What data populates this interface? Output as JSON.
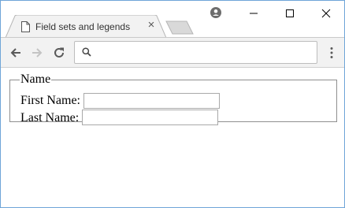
{
  "tab": {
    "title": "Field sets and legends",
    "favicon": "page-icon",
    "close": "×"
  },
  "window_controls": {
    "minimize": "minimize-icon",
    "maximize": "maximize-icon",
    "close": "close-icon"
  },
  "toolbar": {
    "address_value": "",
    "address_placeholder": ""
  },
  "form": {
    "legend": "Name",
    "first_name_label": "First Name:",
    "first_name_value": "",
    "last_name_label": "Last Name:",
    "last_name_value": ""
  },
  "colors": {
    "window_border": "#6fa5d8",
    "toolbar_bg": "#f2f2f2",
    "tab_bg": "#f2f2f2",
    "inactive_tab": "#d9d9d9",
    "fieldset_border": "#8f8f8f"
  }
}
